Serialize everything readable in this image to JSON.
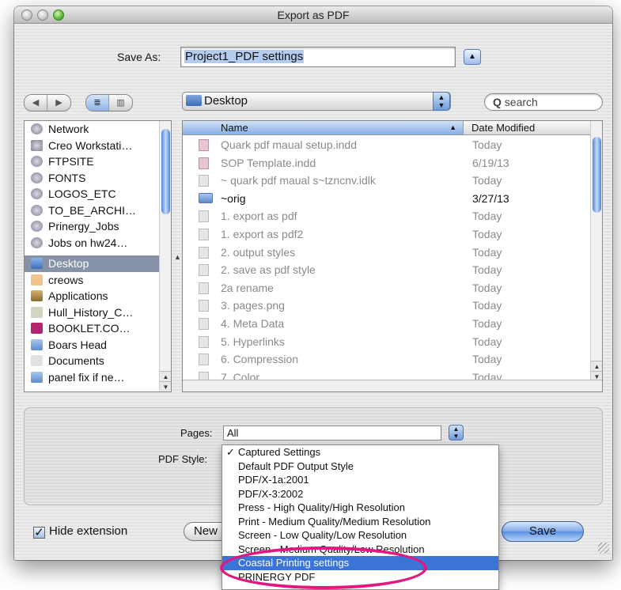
{
  "window": {
    "title": "Export as PDF"
  },
  "save_as": {
    "label": "Save As:",
    "value": "Project1_PDF settings"
  },
  "toolbar": {
    "back_label": "◀",
    "forward_label": "▶",
    "list_view_label": "≣",
    "column_view_label": "▥"
  },
  "location": {
    "folder": "Desktop"
  },
  "search": {
    "placeholder": "search"
  },
  "sidebar": {
    "items": [
      {
        "label": "Network",
        "icon": "network-icon"
      },
      {
        "label": "Creo Workstati…",
        "icon": "workstation-icon"
      },
      {
        "label": "FTPSITE",
        "icon": "server-icon"
      },
      {
        "label": "FONTS",
        "icon": "server-icon"
      },
      {
        "label": "LOGOS_ETC",
        "icon": "server-icon"
      },
      {
        "label": "TO_BE_ARCHI…",
        "icon": "server-icon"
      },
      {
        "label": "Prinergy_Jobs",
        "icon": "server-icon"
      },
      {
        "label": "Jobs on hw24…",
        "icon": "server-icon"
      },
      {
        "label": "Desktop",
        "icon": "desktop-icon",
        "selected": true
      },
      {
        "label": "creows",
        "icon": "home-icon"
      },
      {
        "label": "Applications",
        "icon": "applications-icon"
      },
      {
        "label": "Hull_History_C…",
        "icon": "document-icon"
      },
      {
        "label": "BOOKLET.CO…",
        "icon": "indesign-icon"
      },
      {
        "label": "Boars Head",
        "icon": "folder-icon"
      },
      {
        "label": "Documents",
        "icon": "documents-icon"
      },
      {
        "label": "panel fix if ne…",
        "icon": "folder-icon"
      }
    ]
  },
  "file_list": {
    "columns": {
      "name": "Name",
      "date": "Date Modified"
    },
    "rows": [
      {
        "name": "Quark pdf maual setup.indd",
        "date": "Today",
        "icon": "indd"
      },
      {
        "name": "SOP Template.indd",
        "date": "6/19/13",
        "icon": "indd"
      },
      {
        "name": "~ quark pdf maual s~tzncnv.idlk",
        "date": "Today",
        "icon": "doc"
      },
      {
        "name": "~orig",
        "date": "3/27/13",
        "icon": "folder",
        "active": true
      },
      {
        "name": "1. export as pdf",
        "date": "Today",
        "icon": "img"
      },
      {
        "name": "1. export as pdf2",
        "date": "Today",
        "icon": "img"
      },
      {
        "name": "2. output styles",
        "date": "Today",
        "icon": "img"
      },
      {
        "name": "2. save as pdf style",
        "date": "Today",
        "icon": "img"
      },
      {
        "name": "2a rename",
        "date": "Today",
        "icon": "img"
      },
      {
        "name": "3. pages.png",
        "date": "Today",
        "icon": "img"
      },
      {
        "name": "4. Meta Data",
        "date": "Today",
        "icon": "img"
      },
      {
        "name": "5. Hyperlinks",
        "date": "Today",
        "icon": "img"
      },
      {
        "name": "6. Compression",
        "date": "Today",
        "icon": "img"
      },
      {
        "name": "7. Color",
        "date": "Today",
        "icon": "img"
      }
    ]
  },
  "pages": {
    "label": "Pages:",
    "value": "All"
  },
  "pdf_style": {
    "label": "PDF Style:",
    "options": [
      {
        "label": "Captured Settings",
        "checked": true
      },
      {
        "label": "Default PDF Output Style"
      },
      {
        "label": "PDF/X-1a:2001"
      },
      {
        "label": "PDF/X-3:2002"
      },
      {
        "label": "Press - High Quality/High Resolution"
      },
      {
        "label": "Print - Medium Quality/Medium Resolution"
      },
      {
        "label": "Screen - Low Quality/Low Resolution"
      },
      {
        "label": "Screen - Medium Quality/Low Resolution"
      },
      {
        "label": "Coastal Printing settings",
        "highlighted": true
      },
      {
        "label": "PRINERGY PDF"
      }
    ]
  },
  "footer": {
    "hide_extension_label": "Hide extension",
    "new_folder_label": "New",
    "save_label": "Save"
  },
  "colors": {
    "selection": "#3a74d7",
    "annotation_ring": "#e0187f",
    "sidebar_selected": "#8592a8"
  }
}
